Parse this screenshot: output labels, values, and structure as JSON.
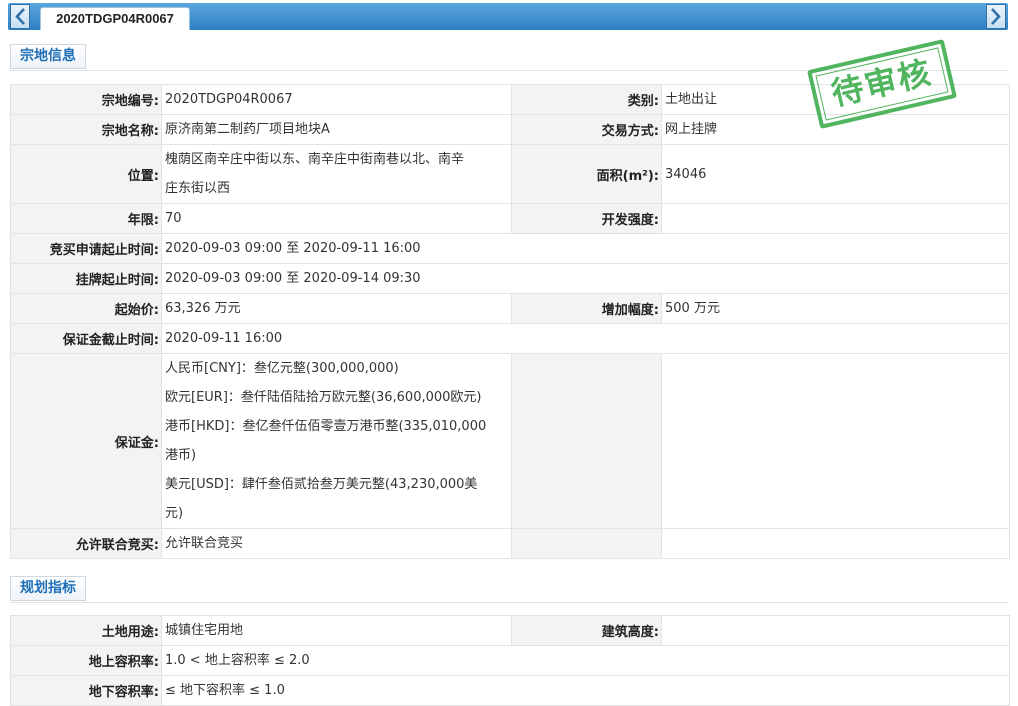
{
  "tab": {
    "title": "2020TDGP04R0067"
  },
  "stamp": {
    "text": "待审核"
  },
  "section1": {
    "title": "宗地信息",
    "rows": {
      "code_label": "宗地编号:",
      "code": "2020TDGP04R0067",
      "type_label": "类别:",
      "type": "土地出让",
      "name_label": "宗地名称:",
      "name": "原济南第二制药厂项目地块A",
      "trade_label": "交易方式:",
      "trade": "网上挂牌",
      "loc_label": "位置:",
      "loc1": "槐荫区南辛庄中街以东、南辛庄中街南巷以北、南辛",
      "loc2": "庄东街以西",
      "area_label": "面积(m²):",
      "area": "34046",
      "term_label": "年限:",
      "term": "70",
      "dev_label": "开发强度:",
      "dev": "",
      "apply_label": "竞买申请起止时间:",
      "apply": "2020-09-03 09:00 至 2020-09-11 16:00",
      "list_label": "挂牌起止时间:",
      "list": "2020-09-03 09:00 至 2020-09-14 09:30",
      "start_label": "起始价:",
      "start": "63,326 万元",
      "inc_label": "增加幅度:",
      "inc": "500 万元",
      "deposit_deadline_label": "保证金截止时间:",
      "deposit_deadline": "2020-09-11 16:00",
      "deposit_label": "保证金:",
      "deposit_lines": [
        "人民币[CNY]：叁亿元整(300,000,000)",
        "欧元[EUR]：叁仟陆佰陆拾万欧元整(36,600,000欧元)",
        "港币[HKD]：叁亿叁仟伍佰零壹万港币整(335,010,000",
        "港币)",
        "美元[USD]：肆仟叁佰贰拾叁万美元整(43,230,000美",
        "元)"
      ],
      "joint_label": "允许联合竞买:",
      "joint": "允许联合竞买"
    }
  },
  "section2": {
    "title": "规划指标",
    "rows": {
      "use_label": "土地用途:",
      "use": "城镇住宅用地",
      "height_label": "建筑高度:",
      "height": "",
      "above_label": "地上容积率:",
      "above": "1.0 < 地上容积率 ≤ 2.0",
      "below_label": "地下容积率:",
      "below": "≤ 地下容积率 ≤ 1.0"
    }
  }
}
